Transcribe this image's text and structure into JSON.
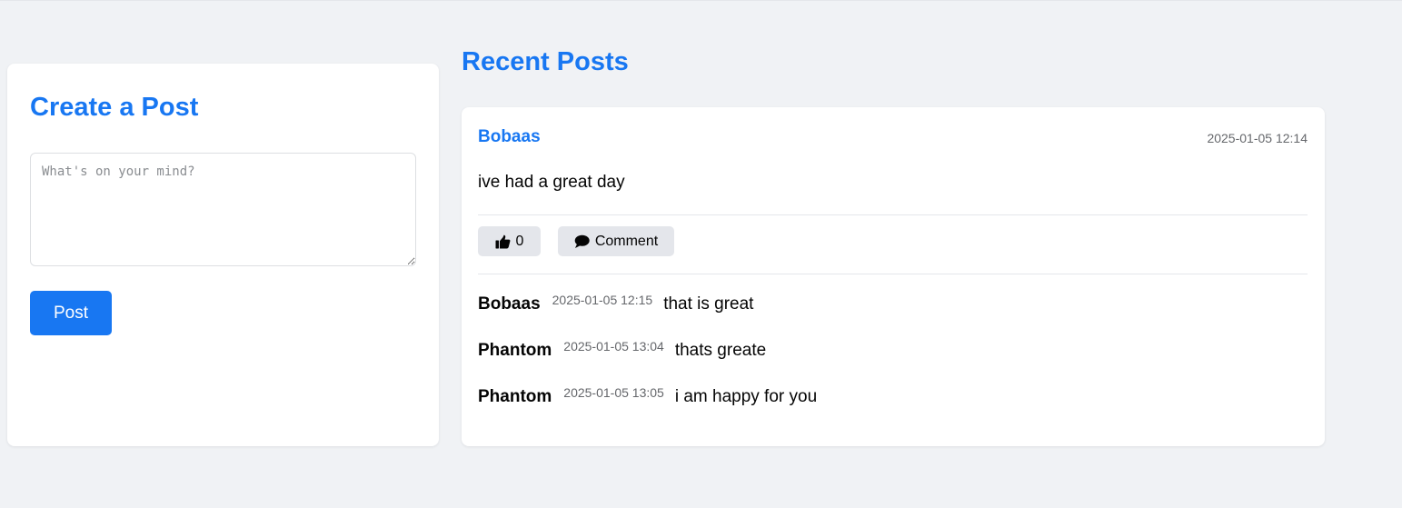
{
  "colors": {
    "accent": "#1877f2",
    "background": "#f0f2f5",
    "card": "#ffffff",
    "button_gray": "#e4e6eb",
    "muted_text": "#65676b"
  },
  "create_post": {
    "title": "Create a Post",
    "textarea_placeholder": "What's on your mind?",
    "textarea_value": "",
    "submit_label": "Post"
  },
  "feed": {
    "title": "Recent Posts",
    "posts": [
      {
        "author": "Bobaas",
        "timestamp": "2025-01-05 12:14",
        "content": "ive had a great day",
        "like_icon": "thumbs-up-icon",
        "like_count": "0",
        "comment_icon": "comment-bubble-icon",
        "comment_label": "Comment",
        "comments": [
          {
            "author": "Bobaas",
            "timestamp": "2025-01-05 12:15",
            "text": "that is great"
          },
          {
            "author": "Phantom",
            "timestamp": "2025-01-05 13:04",
            "text": "thats greate"
          },
          {
            "author": "Phantom",
            "timestamp": "2025-01-05 13:05",
            "text": "i am happy for you"
          }
        ]
      }
    ]
  }
}
